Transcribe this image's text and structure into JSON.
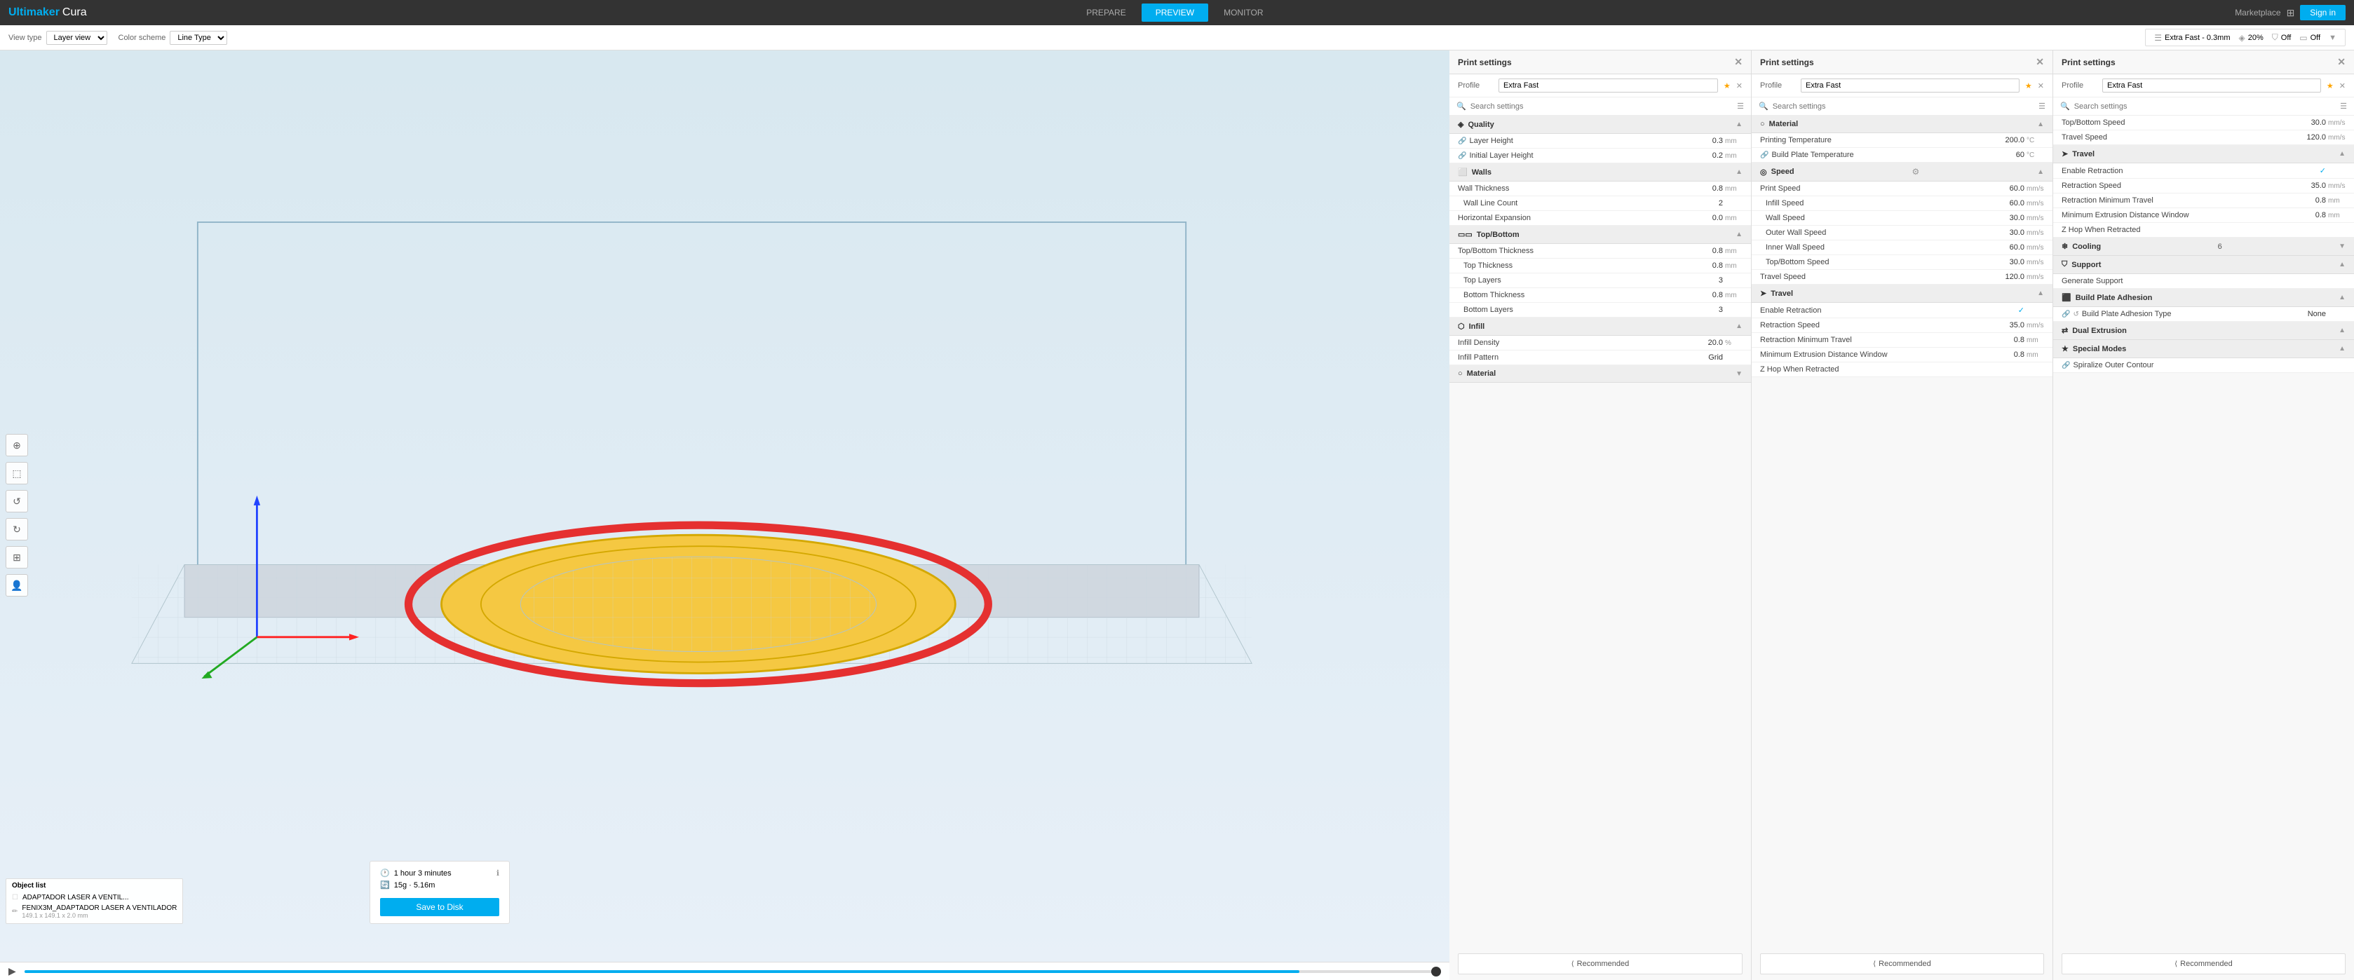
{
  "brand": {
    "u": "Ultimaker",
    "cura": "Cura"
  },
  "nav": {
    "prepare": "PREPARE",
    "preview": "PREVIEW",
    "monitor": "MONITOR",
    "marketplace": "Marketplace",
    "sign_in": "Sign in"
  },
  "second_bar": {
    "view_type_label": "View type",
    "view_type_value": "Layer view",
    "color_scheme_label": "Color scheme",
    "color_scheme_value": "Line Type"
  },
  "extra_fast_bar": {
    "profile": "Extra Fast - 0.3mm",
    "infill": "20%",
    "support": "Off",
    "adhesion": "Off"
  },
  "print_panels": [
    {
      "title": "Print settings",
      "profile_label": "Profile",
      "profile_value": "Extra Fast",
      "search_placeholder": "Search settings",
      "sections": [
        {
          "name": "Quality",
          "icon": "◈",
          "settings": [
            {
              "label": "Layer Height",
              "value": "0.3",
              "unit": "mm",
              "has_link": true
            },
            {
              "label": "Initial Layer Height",
              "value": "0.2",
              "unit": "mm",
              "has_link": true
            }
          ]
        },
        {
          "name": "Walls",
          "icon": "⬜",
          "settings": [
            {
              "label": "Wall Thickness",
              "value": "0.8",
              "unit": "mm"
            },
            {
              "label": "Wall Line Count",
              "value": "2",
              "unit": "",
              "indent": true
            },
            {
              "label": "Horizontal Expansion",
              "value": "0.0",
              "unit": "mm"
            }
          ]
        },
        {
          "name": "Top/Bottom",
          "icon": "▭",
          "settings": [
            {
              "label": "Top/Bottom Thickness",
              "value": "0.8",
              "unit": "mm"
            },
            {
              "label": "Top Thickness",
              "value": "0.8",
              "unit": "mm",
              "indent": true
            },
            {
              "label": "Top Layers",
              "value": "3",
              "unit": "",
              "indent": true
            },
            {
              "label": "Bottom Thickness",
              "value": "0.8",
              "unit": "mm",
              "indent": true
            },
            {
              "label": "Bottom Layers",
              "value": "3",
              "unit": "",
              "indent": true
            }
          ]
        },
        {
          "name": "Infill",
          "icon": "⬡",
          "settings": [
            {
              "label": "Infill Density",
              "value": "20.0",
              "unit": "%"
            },
            {
              "label": "Infill Pattern",
              "value": "Grid",
              "unit": ""
            }
          ]
        },
        {
          "name": "Material",
          "icon": "○"
        }
      ],
      "recommended_label": "Recommended"
    },
    {
      "title": "Print settings",
      "profile_label": "Profile",
      "profile_value": "Extra Fast",
      "search_placeholder": "Search settings",
      "sections": [
        {
          "name": "Material",
          "icon": "○",
          "settings": [
            {
              "label": "Printing Temperature",
              "value": "200.0",
              "unit": "°C"
            },
            {
              "label": "Build Plate Temperature",
              "value": "60",
              "unit": "°C",
              "has_link": true
            }
          ]
        },
        {
          "name": "Speed",
          "icon": "◎",
          "settings": [
            {
              "label": "Print Speed",
              "value": "60.0",
              "unit": "mm/s"
            },
            {
              "label": "Infill Speed",
              "value": "60.0",
              "unit": "mm/s",
              "indent": true
            },
            {
              "label": "Wall Speed",
              "value": "30.0",
              "unit": "mm/s",
              "indent": true
            },
            {
              "label": "Outer Wall Speed",
              "value": "30.0",
              "unit": "mm/s",
              "indent": true
            },
            {
              "label": "Inner Wall Speed",
              "value": "60.0",
              "unit": "mm/s",
              "indent": true
            },
            {
              "label": "Top/Bottom Speed",
              "value": "30.0",
              "unit": "mm/s",
              "indent": true
            },
            {
              "label": "Travel Speed",
              "value": "120.0",
              "unit": "mm/s"
            }
          ]
        },
        {
          "name": "Travel",
          "icon": "➤",
          "settings": [
            {
              "label": "Enable Retraction",
              "value": "✓",
              "unit": ""
            },
            {
              "label": "Retraction Speed",
              "value": "35.0",
              "unit": "mm/s"
            },
            {
              "label": "Retraction Minimum Travel",
              "value": "0.8",
              "unit": "mm"
            },
            {
              "label": "Minimum Extrusion Distance Window",
              "value": "0.8",
              "unit": "mm"
            },
            {
              "label": "Z Hop When Retracted",
              "value": "",
              "unit": ""
            }
          ]
        }
      ],
      "recommended_label": "Recommended"
    },
    {
      "title": "Print settings",
      "profile_label": "Profile",
      "profile_value": "Extra Fast",
      "search_placeholder": "Search settings",
      "sections": [
        {
          "name": "Top/Bottom Speed",
          "value": "30.0",
          "unit": "mm/s",
          "no_icon": true
        },
        {
          "name": "Travel Speed",
          "value": "120.0",
          "unit": "mm/s",
          "no_icon": true
        },
        {
          "name": "Travel",
          "icon": "➤",
          "settings": [
            {
              "label": "Enable Retraction",
              "value": "✓",
              "unit": ""
            },
            {
              "label": "Retraction Speed",
              "value": "35.0",
              "unit": "mm/s"
            },
            {
              "label": "Retraction Minimum Travel",
              "value": "0.8",
              "unit": "mm"
            },
            {
              "label": "Minimum Extrusion Distance Window",
              "value": "0.8",
              "unit": "mm"
            },
            {
              "label": "Z Hop When Retracted",
              "value": "",
              "unit": ""
            }
          ]
        },
        {
          "name": "Cooling",
          "icon": "❄"
        },
        {
          "name": "Support",
          "icon": "⛉"
        },
        {
          "name": "Generate Support",
          "settings": []
        },
        {
          "name": "Build Plate Adhesion",
          "icon": "⬛"
        },
        {
          "name": "Build Plate Adhesion Type",
          "value": "None",
          "no_icon": true
        },
        {
          "name": "Dual Extrusion",
          "icon": "⇄"
        },
        {
          "name": "Special Modes",
          "icon": "★"
        },
        {
          "name": "Spiralize Outer Contour",
          "settings": []
        }
      ],
      "recommended_label": "Recommended"
    }
  ],
  "object_list": {
    "title": "Object list",
    "items": [
      {
        "name": "ADAPTADOR LASER A VENTIL..."
      },
      {
        "name": "FENIX3M_ADAPTADOR LASER A VENTILADOR",
        "sub": "149.1 x 149.1 x 2.0 mm"
      }
    ]
  },
  "info_panel": {
    "time": "1 hour 3 minutes",
    "weight": "15g · 5.16m",
    "save_label": "Save to Disk"
  },
  "tools": [
    "↕",
    "⬚",
    "↺",
    "…",
    "⊞",
    "👤"
  ]
}
